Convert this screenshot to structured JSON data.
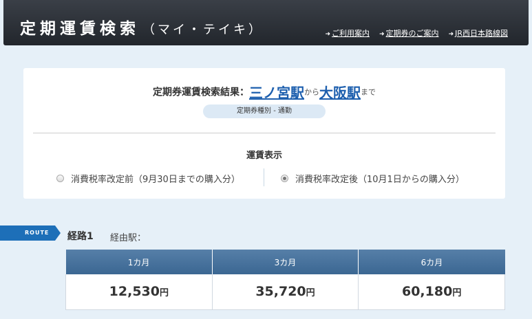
{
  "header": {
    "title": "定期運賃検索",
    "subtitle": "（マイ・テイキ）",
    "links": [
      {
        "label": "ご利用案内"
      },
      {
        "label": "定期券のご案内"
      },
      {
        "label": "JR西日本路線図"
      }
    ]
  },
  "result": {
    "label": "定期券運賃検索結果：",
    "from_station": "三ノ宮駅",
    "from_suffix": "から",
    "to_station": "大阪駅",
    "to_suffix": "まで",
    "pass_type": "定期券種別 - 通勤"
  },
  "fare_display": {
    "label": "運賃表示",
    "option_before": "消費税率改定前（9月30日までの購入分）",
    "option_after": "消費税率改定後（10月1日からの購入分）",
    "selected": "after"
  },
  "route": {
    "tag": "ROUTE",
    "title": "経路1",
    "via_label": "経由駅：",
    "columns": [
      "1カ月",
      "3カ月",
      "6カ月"
    ],
    "fares": [
      "12,530",
      "35,720",
      "60,180"
    ],
    "yen": "円"
  },
  "colors": {
    "header_bg": "#2c3037",
    "station_link": "#1d5fae",
    "route_tag": "#1d6fb8",
    "table_header": "#4a74a0",
    "page_bg": "#e6f0f8"
  }
}
